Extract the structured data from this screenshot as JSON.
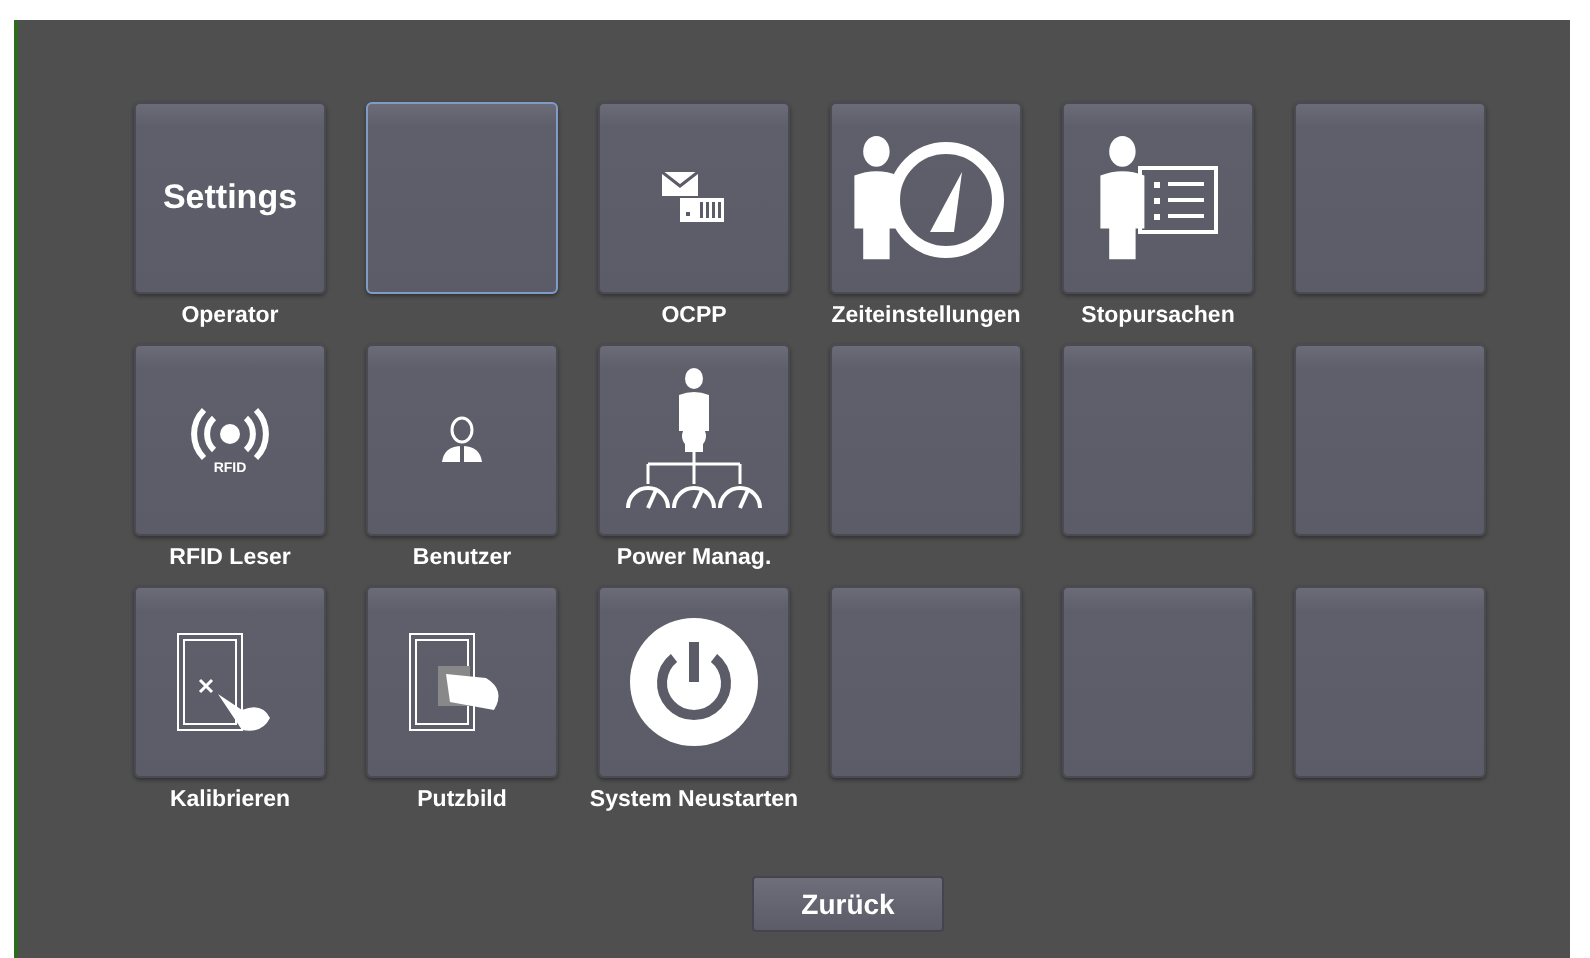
{
  "tiles": [
    {
      "kind": "text",
      "text": "Settings",
      "label": "Operator",
      "selected": false
    },
    {
      "kind": "blank",
      "selected": true
    },
    {
      "kind": "mail",
      "label": "OCPP",
      "selected": false
    },
    {
      "kind": "clock",
      "label": "Zeiteinstellungen",
      "selected": false
    },
    {
      "kind": "list",
      "label": "Stopursachen",
      "selected": false
    },
    {
      "kind": "blank",
      "selected": false
    },
    {
      "kind": "rfid",
      "text": "RFID",
      "label": "RFID Leser",
      "selected": false
    },
    {
      "kind": "user",
      "label": "Benutzer",
      "selected": false
    },
    {
      "kind": "power-tree",
      "label": "Power Manag.",
      "selected": false
    },
    {
      "kind": "blank",
      "selected": false
    },
    {
      "kind": "blank",
      "selected": false
    },
    {
      "kind": "blank",
      "selected": false
    },
    {
      "kind": "calibrate",
      "label": "Kalibrieren",
      "selected": false
    },
    {
      "kind": "wipe",
      "label": "Putzbild",
      "selected": false
    },
    {
      "kind": "power",
      "label": "System Neustarten",
      "selected": false
    },
    {
      "kind": "blank",
      "selected": false
    },
    {
      "kind": "blank",
      "selected": false
    },
    {
      "kind": "blank",
      "selected": false
    }
  ],
  "back_button": "Zurück"
}
